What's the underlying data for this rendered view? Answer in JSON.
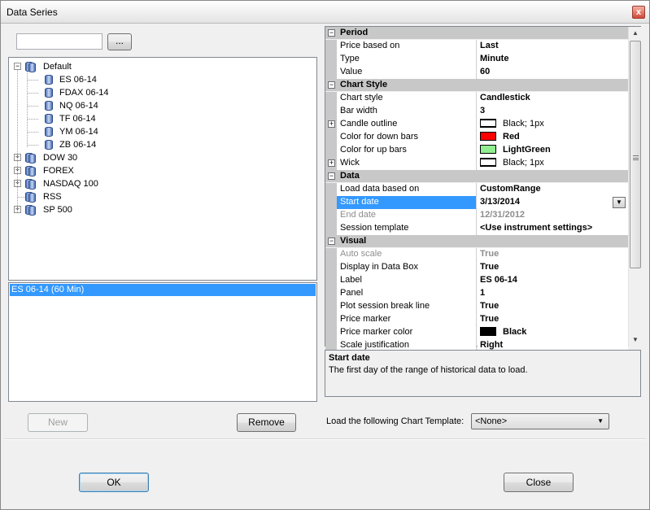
{
  "window": {
    "title": "Data Series",
    "close_glyph": "x"
  },
  "search": {
    "value": "",
    "browse_label": "..."
  },
  "tree": {
    "items": [
      {
        "label": "Default",
        "toggle": "−",
        "level": 0
      },
      {
        "label": "ES 06-14",
        "level": 1
      },
      {
        "label": "FDAX 06-14",
        "level": 1
      },
      {
        "label": "NQ 06-14",
        "level": 1
      },
      {
        "label": "TF 06-14",
        "level": 1
      },
      {
        "label": "YM 06-14",
        "level": 1
      },
      {
        "label": "ZB 06-14",
        "level": 1
      },
      {
        "label": "DOW 30",
        "toggle": "+",
        "level": 0
      },
      {
        "label": "FOREX",
        "toggle": "+",
        "level": 0
      },
      {
        "label": "NASDAQ 100",
        "toggle": "+",
        "level": 0
      },
      {
        "label": "RSS",
        "level": 0
      },
      {
        "label": "SP 500",
        "toggle": "+",
        "level": 0
      }
    ]
  },
  "series": {
    "selected": "ES 06-14 (60 Min)"
  },
  "buttons": {
    "new": "New",
    "remove": "Remove",
    "ok": "OK",
    "close": "Close"
  },
  "grid": {
    "rows": [
      {
        "type": "cat",
        "name": "Period",
        "toggle": "−"
      },
      {
        "name": "Price based on",
        "value": "Last"
      },
      {
        "name": "Type",
        "value": "Minute"
      },
      {
        "name": "Value",
        "value": "60"
      },
      {
        "type": "cat",
        "name": "Chart Style",
        "toggle": "−"
      },
      {
        "name": "Chart style",
        "value": "Candlestick"
      },
      {
        "name": "Bar width",
        "value": "3"
      },
      {
        "name": "Candle outline",
        "value": "Black; 1px",
        "toggle": "+",
        "swatch": "line",
        "normal": true
      },
      {
        "name": "Color for down bars",
        "value": "Red",
        "swatch": "#ff0000"
      },
      {
        "name": "Color for up bars",
        "value": "LightGreen",
        "swatch": "#90ee90"
      },
      {
        "name": "Wick",
        "value": "Black; 1px",
        "toggle": "+",
        "swatch": "line",
        "normal": true
      },
      {
        "type": "cat",
        "name": "Data",
        "toggle": "−"
      },
      {
        "name": "Load data based on",
        "value": "CustomRange"
      },
      {
        "name": "Start date",
        "value": "3/13/2014",
        "selected": true,
        "dropdown": "▼"
      },
      {
        "name": "End date",
        "value": "12/31/2012",
        "disabled": true
      },
      {
        "name": "Session template",
        "value": "<Use instrument settings>"
      },
      {
        "type": "cat",
        "name": "Visual",
        "toggle": "−"
      },
      {
        "name": "Auto scale",
        "value": "True",
        "disabled": true
      },
      {
        "name": "Display in Data Box",
        "value": "True"
      },
      {
        "name": "Label",
        "value": "ES 06-14"
      },
      {
        "name": "Panel",
        "value": "1"
      },
      {
        "name": "Plot session break line",
        "value": "True"
      },
      {
        "name": "Price marker",
        "value": "True"
      },
      {
        "name": "Price marker color",
        "value": "Black",
        "swatch": "#000000"
      },
      {
        "name": "Scale justification",
        "value": "Right"
      }
    ],
    "scroll_up": "▲",
    "scroll_down": "▼"
  },
  "help": {
    "title": "Start date",
    "description": "The first day of the range of historical data to load."
  },
  "template": {
    "label": "Load the following Chart Template:",
    "selected": "<None>",
    "arrow": "▼"
  }
}
